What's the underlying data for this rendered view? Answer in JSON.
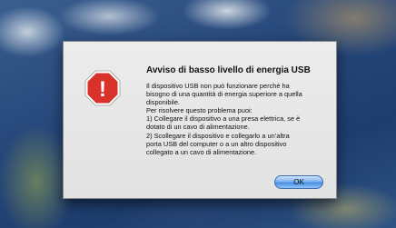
{
  "dialog": {
    "title": "Avviso di basso livello di energia USB",
    "message": "Il dispositivo USB non può funzionare perché ha\nbisogno di una quantità di energia superiore a quella\ndisponibile.\nPer risolvere questo problema puoi:\n1) Collegare il dispositivo a una presa elettrica, se è\ndotato di un cavo di alimentazione.\n2) Scollegare il dispositivo e collegarlo a un’altra\nporta USB del computer o a un altro dispositivo\ncollegato a un cavo di alimentazione.",
    "ok_label": "OK",
    "icon": "stop-sign-alert-icon",
    "icon_glyph": "!"
  },
  "colors": {
    "stop_red": "#d8322a",
    "button_blue": "#5a9be6"
  }
}
